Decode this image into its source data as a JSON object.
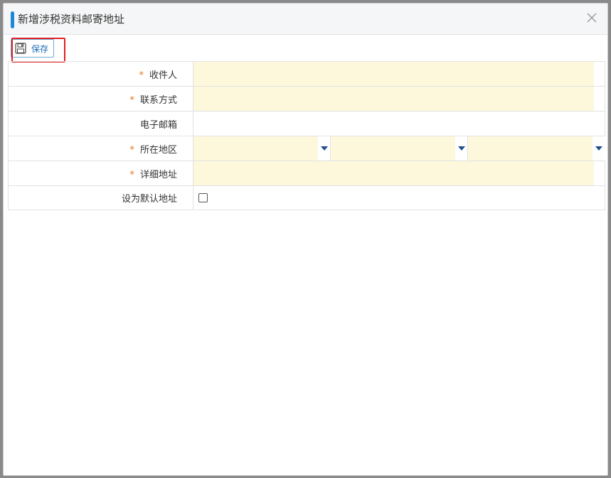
{
  "dialog": {
    "title": "新增涉税资料邮寄地址",
    "close_icon": "close-icon"
  },
  "toolbar": {
    "save_label": "保存",
    "save_icon": "floppy-disk-icon"
  },
  "form": {
    "required_mark": "*",
    "recipient_label": "收件人",
    "contact_label": "联系方式",
    "email_label": "电子邮箱",
    "region_label": "所在地区",
    "address_label": "详细地址",
    "default_label": "设为默认地址",
    "recipient_value": "",
    "contact_value": "",
    "email_value": "",
    "address_value": "",
    "default_checked": false
  },
  "colors": {
    "required_field_bg": "#fdf8dc",
    "accent": "#1e88d8",
    "required_mark": "#e8741a",
    "highlight_box": "#e02020"
  }
}
